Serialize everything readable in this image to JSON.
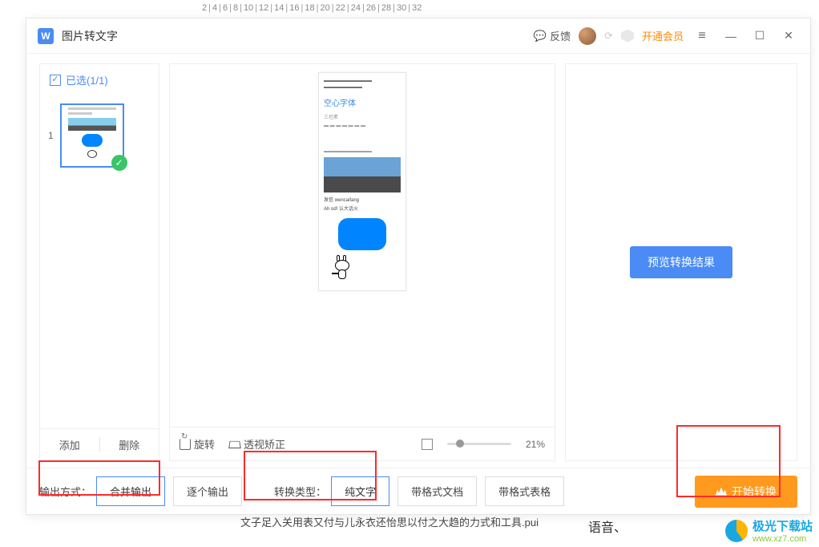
{
  "ruler": {
    "ticks": [
      "2",
      "4",
      "6",
      "8",
      "10",
      "12",
      "14",
      "16",
      "18",
      "20",
      "22",
      "24",
      "26",
      "28",
      "30",
      "32"
    ]
  },
  "titlebar": {
    "title": "图片转文字",
    "feedback": "反馈",
    "vip": "开通会员"
  },
  "left_panel": {
    "select_label": "已选(1/1)",
    "thumb_index": "1",
    "add": "添加",
    "delete": "删除"
  },
  "mid_panel": {
    "preview_doc": {
      "heading": "空心字体",
      "sub": "三坦素",
      "cap1": "发信 wencaifang",
      "cap2": "Ah od! 认大话火"
    },
    "rotate": "旋转",
    "perspective": "透视矫正",
    "zoom": "21%"
  },
  "right_panel": {
    "preview_result": "预览转换结果"
  },
  "bottom": {
    "output_label": "输出方式：",
    "output_merge": "合并输出",
    "output_each": "逐个输出",
    "type_label": "转换类型：",
    "type_text": "纯文字",
    "type_doc": "带格式文档",
    "type_table": "带格式表格",
    "convert": "开始转换"
  },
  "background": {
    "doc_line": "文子足入关用表又付与儿永衣还怡思以付之大趋的力式和工具.pui",
    "speech": "语音、"
  },
  "watermark": {
    "name": "极光下载站",
    "url": "www.xz7.com"
  }
}
